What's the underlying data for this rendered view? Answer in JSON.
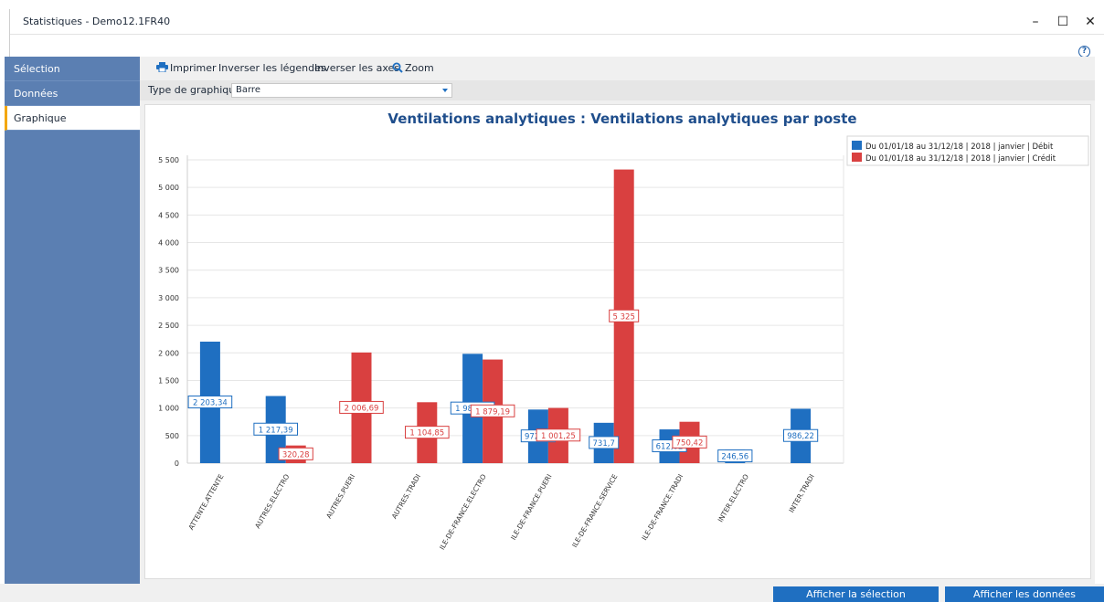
{
  "window": {
    "title": "Statistiques - Demo12.1FR40",
    "minimize": "–",
    "maximize": "☐",
    "close": "✕",
    "help": "?"
  },
  "sidebar": {
    "items": [
      {
        "label": "Sélection",
        "active": false
      },
      {
        "label": "Données",
        "active": false
      },
      {
        "label": "Graphique",
        "active": true
      }
    ]
  },
  "toolbar": {
    "print_label": "Imprimer",
    "invert_legends_label": "Inverser les légendes",
    "invert_axes_label": "Inverser les axes",
    "zoom_label": "Zoom"
  },
  "chart_type": {
    "label": "Type de graphique",
    "value": "Barre"
  },
  "chart_data": {
    "type": "bar",
    "title": "Ventilations analytiques : Ventilations analytiques par poste",
    "categories": [
      "ATTENTE.ATTENTE",
      "AUTRES.ELECTRO",
      "AUTRES.PUERI",
      "AUTRES.TRADI",
      "ILE-DE-FRANCE.ELECTRO",
      "ILE-DE-FRANCE.PUERI",
      "ILE-DE-FRANCE.SERVICE",
      "ILE-DE-FRANCE.TRADI",
      "INTER.ELECTRO",
      "INTER.TRADI"
    ],
    "series": [
      {
        "name": "Du 01/01/18 au 31/12/18 | 2018 | janvier | Débit",
        "color": "#1f6fc1",
        "values": [
          2203.34,
          1217.39,
          null,
          null,
          1982.59,
          972.02,
          731.7,
          612.02,
          246.56,
          986.22
        ],
        "labels": [
          "2 203,34",
          "1 217,39",
          "",
          "",
          "1 982,59",
          "972,02",
          "731,7",
          "612,02",
          "246,56",
          "986,22"
        ]
      },
      {
        "name": "Du 01/01/18 au 31/12/18 | 2018 | janvier | Crédit",
        "color": "#d94040",
        "values": [
          null,
          320.28,
          2006.69,
          1104.85,
          1879.19,
          1001.25,
          5325,
          750.42,
          null,
          null
        ],
        "labels": [
          "",
          "320,28",
          "2 006,69",
          "1 104,85",
          "1 879,19",
          "1 001,25",
          "5 325",
          "750,42",
          "",
          ""
        ]
      }
    ],
    "y_ticks": [
      "0",
      "500",
      "1 000",
      "1 500",
      "2 000",
      "2 500",
      "3 000",
      "3 500",
      "4 000",
      "4 500",
      "5 000",
      "5 500"
    ],
    "ylim": [
      0,
      5500
    ],
    "grid": true,
    "legend_position": "top-right"
  },
  "buttons": {
    "show_selection": "Afficher la sélection",
    "show_data": "Afficher les données"
  }
}
